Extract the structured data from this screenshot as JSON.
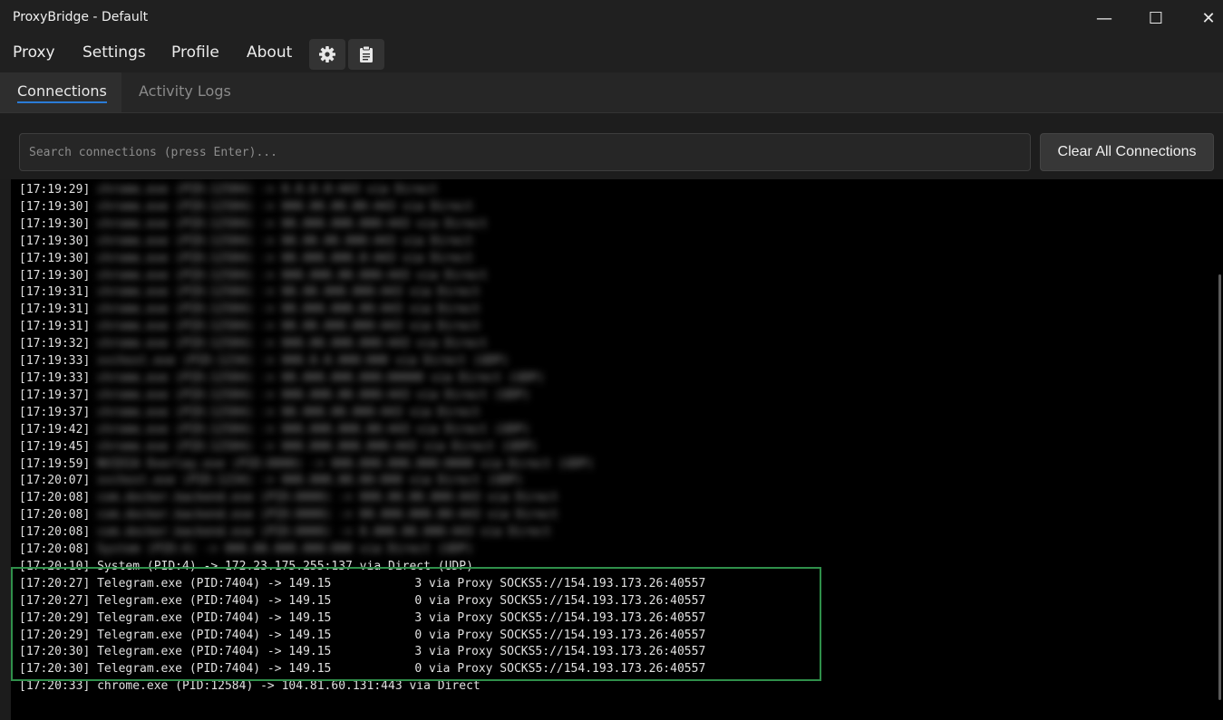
{
  "window": {
    "title": "ProxyBridge - Default",
    "minimize": "—",
    "maximize": "☐",
    "close": "✕"
  },
  "menu": [
    "Proxy",
    "Settings",
    "Profile",
    "About"
  ],
  "toolbar_icons": [
    "gear-icon",
    "clipboard-icon"
  ],
  "tabs": [
    "Connections",
    "Activity Logs"
  ],
  "search": {
    "placeholder": "Search connections (press Enter)...",
    "value": ""
  },
  "clear_button": "Clear All Connections",
  "colors": {
    "highlight_border": "#2f8f4a",
    "tab_underline": "#2a7bd6"
  },
  "log_lines": [
    {
      "time": "[17:19:29]",
      "text": "chrome.exe (PID:12584) -> 0.0.0.0:443 via Direct",
      "blur": true
    },
    {
      "time": "[17:19:30]",
      "text": "chrome.exe (PID:12584) -> 000.00.00.00:443 via Direct",
      "blur": true
    },
    {
      "time": "[17:19:30]",
      "text": "chrome.exe (PID:12584) -> 00.000.000.000:443 via Direct",
      "blur": true
    },
    {
      "time": "[17:19:30]",
      "text": "chrome.exe (PID:12584) -> 00.00.00.000:443 via Direct",
      "blur": true
    },
    {
      "time": "[17:19:30]",
      "text": "chrome.exe (PID:12584) -> 00.000.000.0:443 via Direct",
      "blur": true
    },
    {
      "time": "[17:19:30]",
      "text": "chrome.exe (PID:12584) -> 000.000.00.000:443 via Direct",
      "blur": true
    },
    {
      "time": "[17:19:31]",
      "text": "chrome.exe (PID:12584) -> 00.00.000.000:443 via Direct",
      "blur": true
    },
    {
      "time": "[17:19:31]",
      "text": "chrome.exe (PID:12584) -> 00.000.000.00:443 via Direct",
      "blur": true
    },
    {
      "time": "[17:19:31]",
      "text": "chrome.exe (PID:12584) -> 00.00.000.000:443 via Direct",
      "blur": true
    },
    {
      "time": "[17:19:32]",
      "text": "chrome.exe (PID:12584) -> 000.00.000.000:443 via Direct",
      "blur": true
    },
    {
      "time": "[17:19:33]",
      "text": "svchost.exe (PID:1234) -> 000.0.0.000:000 via Direct (UDP)",
      "blur": true
    },
    {
      "time": "[17:19:33]",
      "text": "chrome.exe (PID:12584) -> 00.000.000.000:00000 via Direct (UDP)",
      "blur": true
    },
    {
      "time": "[17:19:37]",
      "text": "chrome.exe (PID:12584) -> 000.000.00.000:443 via Direct (UDP)",
      "blur": true
    },
    {
      "time": "[17:19:37]",
      "text": "chrome.exe (PID:12584) -> 00.000.00.000:443 via Direct",
      "blur": true
    },
    {
      "time": "[17:19:42]",
      "text": "chrome.exe (PID:12584) -> 000.000.000.00:443 via Direct (UDP)",
      "blur": true
    },
    {
      "time": "[17:19:45]",
      "text": "chrome.exe (PID:12584) -> 000.000.000.000:443 via Direct (UDP)",
      "blur": true
    },
    {
      "time": "[17:19:59]",
      "text": "NVIDIA Overlay.exe (PID:0000) -> 000.000.000.000:0000 via Direct (UDP)",
      "blur": true
    },
    {
      "time": "[17:20:07]",
      "text": "svchost.exe (PID:1234) -> 000.000.00.00:000 via Direct (UDP)",
      "blur": true
    },
    {
      "time": "[17:20:08]",
      "text": "com.docker.backend.exe (PID:0000) -> 000.00.00.000:443 via Direct",
      "blur": true
    },
    {
      "time": "[17:20:08]",
      "text": "com.docker.backend.exe (PID:0000) -> 00.000.000.00:443 via Direct",
      "blur": true
    },
    {
      "time": "[17:20:08]",
      "text": "com.docker.backend.exe (PID:0000) -> 0.000.00.000:443 via Direct",
      "blur": true
    },
    {
      "time": "[17:20:08]",
      "text": "System (PID:4) -> 000.00.000.000:000 via Direct (UDP)",
      "blur": true
    },
    {
      "time": "[17:20:10]",
      "text": "System (PID:4) -> 172.23.175.255:137 via Direct (UDP)",
      "blur": false
    },
    {
      "time": "[17:20:27]",
      "text": "Telegram.exe (PID:7404) -> 149.15",
      "tail": "3 via Proxy SOCKS5://154.193.173.26:40557",
      "masked": true
    },
    {
      "time": "[17:20:27]",
      "text": "Telegram.exe (PID:7404) -> 149.15",
      "tail": "0 via Proxy SOCKS5://154.193.173.26:40557",
      "masked": true
    },
    {
      "time": "[17:20:29]",
      "text": "Telegram.exe (PID:7404) -> 149.15",
      "tail": "3 via Proxy SOCKS5://154.193.173.26:40557",
      "masked": true
    },
    {
      "time": "[17:20:29]",
      "text": "Telegram.exe (PID:7404) -> 149.15",
      "tail": "0 via Proxy SOCKS5://154.193.173.26:40557",
      "masked": true
    },
    {
      "time": "[17:20:30]",
      "text": "Telegram.exe (PID:7404) -> 149.15",
      "tail": "3 via Proxy SOCKS5://154.193.173.26:40557",
      "masked": true
    },
    {
      "time": "[17:20:30]",
      "text": "Telegram.exe (PID:7404) -> 149.15",
      "tail": "0 via Proxy SOCKS5://154.193.173.26:40557",
      "masked": true
    },
    {
      "time": "[17:20:33]",
      "text": "chrome.exe (PID:12584) -> 104.81.60.131:443 via Direct",
      "blur": false
    }
  ]
}
